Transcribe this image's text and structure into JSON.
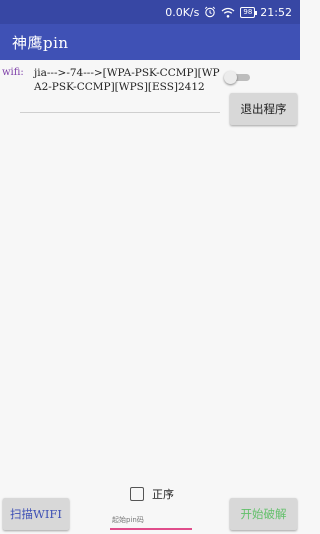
{
  "status_bar": {
    "speed": "0.0K/s",
    "battery": "98",
    "time": "21:52"
  },
  "app_bar": {
    "title": "神鹰pin"
  },
  "wifi": {
    "label": "wifi:",
    "selected_network": "jia--->-74--->[WPA-PSK-CCMP][WPA2-PSK-CCMP][WPS][ESS]2412",
    "toggle_on": false
  },
  "buttons": {
    "exit": "退出程序",
    "scan": "扫描WIFI",
    "start": "开始破解"
  },
  "order": {
    "label": "正序",
    "checked": false
  },
  "pin_input": {
    "placeholder": "起始pin码",
    "value": ""
  },
  "colors": {
    "app_bar": "#3f51b5",
    "status_bar": "#3747a4",
    "wifi_label": "#7e3fa8",
    "scan_text": "#3f51b5",
    "start_text": "#62c06a",
    "input_underline": "#e04d8b"
  }
}
